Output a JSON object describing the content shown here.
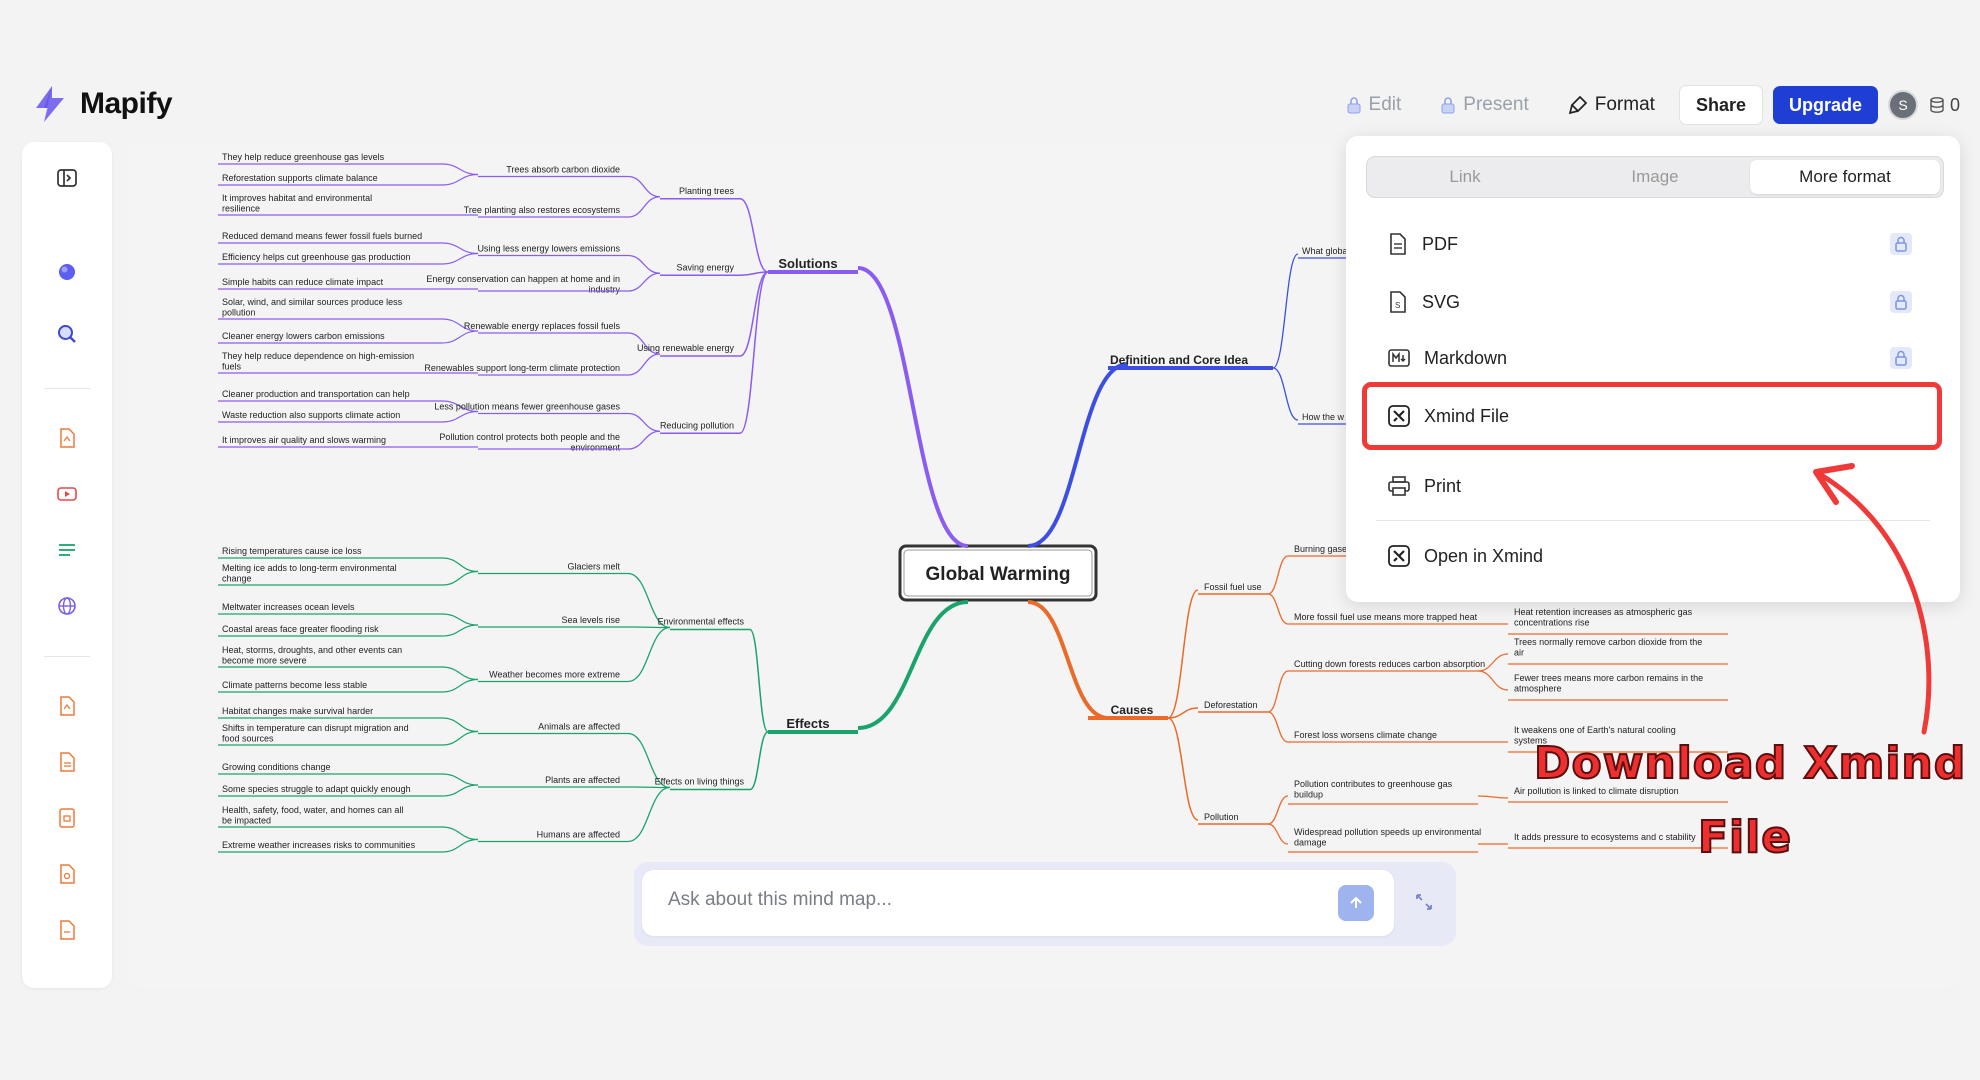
{
  "app": {
    "name": "Mapify"
  },
  "topbar": {
    "edit_label": "Edit",
    "present_label": "Present",
    "format_label": "Format",
    "share_label": "Share",
    "upgrade_label": "Upgrade",
    "avatar_initial": "S",
    "credits": "0"
  },
  "chat": {
    "placeholder": "Ask about this mind map..."
  },
  "format_menu": {
    "tabs": [
      "Link",
      "Image",
      "More format"
    ],
    "selected_tab": "More format",
    "items": [
      {
        "label": "PDF",
        "locked": true
      },
      {
        "label": "SVG",
        "locked": true
      },
      {
        "label": "Markdown",
        "locked": true
      },
      {
        "label": "Xmind File",
        "locked": false,
        "highlighted": true
      },
      {
        "label": "Print",
        "locked": false
      },
      {
        "label": "Open in Xmind",
        "locked": false
      }
    ]
  },
  "annotation": {
    "line1": "Download Xmind",
    "line2": "File"
  },
  "mindmap": {
    "root": "Global Warming",
    "colors": {
      "solutions": "#8a5cf0",
      "definition": "#3d4fe0",
      "effects": "#1aa36a",
      "causes": "#ea6a2a",
      "accent": "#f03a3a"
    },
    "solutions": {
      "label": "Solutions",
      "groups": [
        {
          "label": "Planting trees",
          "children": [
            {
              "label": "Trees absorb carbon dioxide",
              "leaves": [
                "They help reduce greenhouse gas levels",
                "Reforestation supports climate balance"
              ]
            },
            {
              "label": "Tree planting also restores ecosystems",
              "leaves": [
                "It improves habitat and environmental resilience"
              ]
            }
          ]
        },
        {
          "label": "Saving energy",
          "children": [
            {
              "label": "Using less energy lowers emissions",
              "leaves": [
                "Reduced demand means fewer fossil fuels burned",
                "Efficiency helps cut greenhouse gas production"
              ]
            },
            {
              "label": "Energy conservation can happen at home and in industry",
              "leaves": [
                "Simple habits can reduce climate impact"
              ]
            }
          ]
        },
        {
          "label": "Using renewable energy",
          "children": [
            {
              "label": "Renewable energy replaces fossil fuels",
              "leaves": [
                "Solar, wind, and similar sources produce less pollution",
                "Cleaner energy lowers carbon emissions"
              ]
            },
            {
              "label": "Renewables support long-term climate protection",
              "leaves": [
                "They help reduce dependence on high-emission fuels"
              ]
            }
          ]
        },
        {
          "label": "Reducing pollution",
          "children": [
            {
              "label": "Less pollution means fewer greenhouse gases",
              "leaves": [
                "Cleaner production and transportation can help",
                "Waste reduction also supports climate action"
              ]
            },
            {
              "label": "Pollution control protects both people and the environment",
              "leaves": [
                "It improves air quality and slows warming"
              ]
            }
          ]
        }
      ]
    },
    "effects": {
      "label": "Effects",
      "groups": [
        {
          "label": "Environmental effects",
          "children": [
            {
              "label": "Glaciers melt",
              "leaves": [
                "Rising temperatures cause ice loss",
                "Melting ice adds to long-term environmental change"
              ]
            },
            {
              "label": "Sea levels rise",
              "leaves": [
                "Meltwater increases ocean levels",
                "Coastal areas face greater flooding risk"
              ]
            },
            {
              "label": "Weather becomes more extreme",
              "leaves": [
                "Heat, storms, droughts, and other events can become more severe",
                "Climate patterns become less stable"
              ]
            }
          ]
        },
        {
          "label": "Effects on living things",
          "children": [
            {
              "label": "Animals are affected",
              "leaves": [
                "Habitat changes make survival harder",
                "Shifts in temperature can disrupt migration and food sources"
              ]
            },
            {
              "label": "Plants are affected",
              "leaves": [
                "Growing conditions change",
                "Some species struggle to adapt quickly enough"
              ]
            },
            {
              "label": "Humans are affected",
              "leaves": [
                "Health, safety, food, water, and homes can all be impacted",
                "Extreme weather increases risks to communities"
              ]
            }
          ]
        }
      ]
    },
    "definition": {
      "label": "Definition and Core Idea",
      "children": [
        "What globa",
        "How the w"
      ]
    },
    "causes": {
      "label": "Causes",
      "groups": [
        {
          "label": "Fossil fuel use",
          "children": [
            {
              "label": "Burning gases",
              "leaves": []
            },
            {
              "label": "More fossil fuel use means more trapped heat",
              "leaves": [
                "Heat retention increases as atmospheric gas concentrations rise"
              ]
            }
          ]
        },
        {
          "label": "Deforestation",
          "children": [
            {
              "label": "Cutting down forests reduces carbon absorption",
              "leaves": [
                "Trees normally remove carbon dioxide from the air",
                "Fewer trees means more carbon remains in the atmosphere"
              ]
            },
            {
              "label": "Forest loss worsens climate change",
              "leaves": [
                "It weakens one of Earth's natural cooling systems"
              ]
            }
          ]
        },
        {
          "label": "Pollution",
          "children": [
            {
              "label": "Pollution contributes to greenhouse gas buildup",
              "leaves": [
                "Air pollution is linked to climate disruption"
              ]
            },
            {
              "label": "Widespread pollution speeds up environmental damage",
              "leaves": [
                "It adds pressure to ecosystems and c stability"
              ]
            }
          ]
        }
      ]
    }
  }
}
